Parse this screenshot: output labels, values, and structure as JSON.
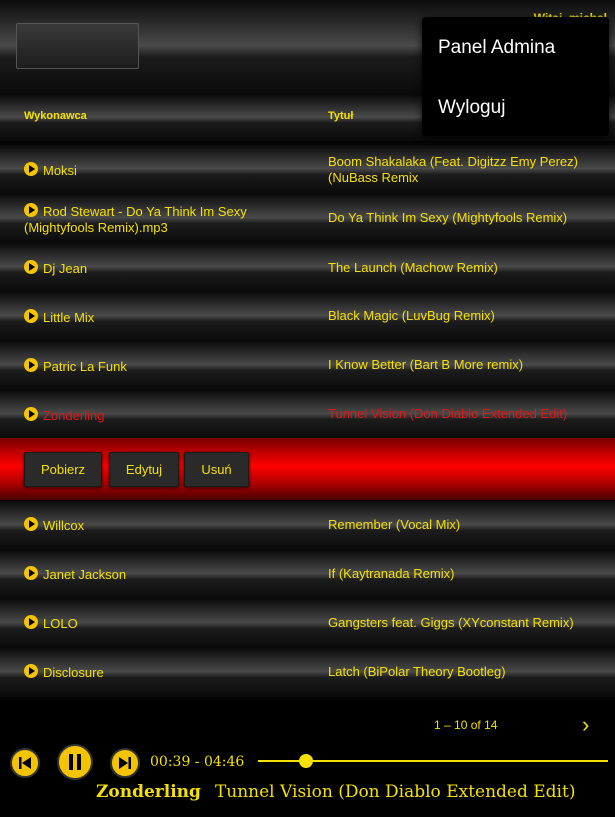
{
  "header": {
    "greeting": "Witaj, michal",
    "menu": [
      "Panel Admina",
      "Wyloguj"
    ]
  },
  "table": {
    "columns": [
      "Wykonawca",
      "Tytuł"
    ],
    "rows": [
      {
        "artist": "Moksi",
        "title": "Boom Shakalaka (Feat. Digitzz Emy Perez) (NuBass Remix"
      },
      {
        "artist": "Rod Stewart - Do Ya Think Im Sexy (Mightyfools Remix).mp3",
        "title": "Do Ya Think Im Sexy (Mightyfools Remix)"
      },
      {
        "artist": "Dj Jean",
        "title": "The Launch (Machow Remix)"
      },
      {
        "artist": "Little Mix",
        "title": "Black Magic (LuvBug Remix)"
      },
      {
        "artist": "Patric La Funk",
        "title": "I Know Better (Bart B More remix)"
      },
      {
        "artist": "Zonderling",
        "title": "Tunnel Vision (Don Diablo Extended Edit)"
      },
      {
        "artist": "Willcox",
        "title": "Remember (Vocal Mix)"
      },
      {
        "artist": "Janet Jackson",
        "title": "If (Kaytranada Remix)"
      },
      {
        "artist": "LOLO",
        "title": "Gangsters feat. Giggs (XYconstant Remix)"
      },
      {
        "artist": "Disclosure",
        "title": "Latch (BiPolar Theory Bootleg)"
      }
    ],
    "active_row": 5,
    "actions": [
      "Pobierz",
      "Edytuj",
      "Usuń"
    ]
  },
  "pagination": {
    "info": "1 – 10 of 14",
    "next_icon": "chevron-right-icon"
  },
  "player": {
    "time": "00:39 - 04:46",
    "progress": 0.136,
    "artist": "Zonderling",
    "title": "Tunnel Vision (Don Diablo Extended Edit)",
    "icons": [
      "skip-previous-icon",
      "pause-icon",
      "skip-next-icon"
    ]
  },
  "colors": {
    "accent": "#f5e100",
    "active": "#e01818",
    "action_bar": "#ff0000"
  }
}
